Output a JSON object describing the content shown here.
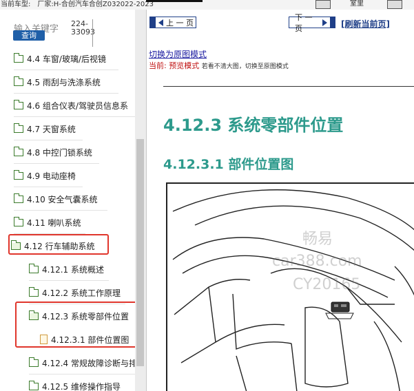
{
  "topbar": {
    "vehicle_label": "当前车型:　厂家:H-合创汽车合创Z032022-2023",
    "right_label": "室里"
  },
  "search": {
    "keyword_label": "输入关键字",
    "button": "查询",
    "code_line1": "224-",
    "code_line2": "33093"
  },
  "tree": [
    {
      "label": "4.4 车窗/玻璃/后视镜",
      "icon": "folder-icon",
      "level": 1
    },
    {
      "label": "4.5 雨刮与洗涤系统",
      "icon": "folder-icon",
      "level": 1
    },
    {
      "label": "4.6 组合仪表/驾驶员信息系",
      "icon": "folder-icon",
      "level": 1
    },
    {
      "label": "4.7 天窗系统",
      "icon": "folder-icon",
      "level": 1
    },
    {
      "label": "4.8 中控门锁系统",
      "icon": "folder-icon",
      "level": 1
    },
    {
      "label": "4.9 电动座椅",
      "icon": "folder-icon",
      "level": 1
    },
    {
      "label": "4.10 安全气囊系统",
      "icon": "folder-icon",
      "level": 1
    },
    {
      "label": "4.11 喇叭系统",
      "icon": "folder-icon",
      "level": 1
    },
    {
      "label": "4.12 行车辅助系统",
      "icon": "folder-open-icon",
      "level": 1
    },
    {
      "label": "4.12.1 系统概述",
      "icon": "folder-icon",
      "level": 2
    },
    {
      "label": "4.12.2 系统工作原理",
      "icon": "folder-icon",
      "level": 2
    },
    {
      "label": "4.12.3 系统零部件位置",
      "icon": "folder-open-icon",
      "level": 2
    },
    {
      "label": "4.12.3.1 部件位置图",
      "icon": "document-icon",
      "level": 3
    },
    {
      "label": "4.12.4 常规故障诊断与排",
      "icon": "folder-icon",
      "level": 2
    },
    {
      "label": "4.12.5 维修操作指导",
      "icon": "folder-icon",
      "level": 2
    }
  ],
  "nav": {
    "prev": "上 一 页",
    "next": "下 一 页",
    "refresh": "[刷新当前页]"
  },
  "mode": {
    "switch_link": "切换为原图模式",
    "current_key": "当前:",
    "current_value": "预览模式",
    "hint": "若看不清大图，切换至原图模式"
  },
  "content": {
    "title": "4.12.3 系统零部件位置",
    "subtitle": "4.12.3.1 部件位置图"
  },
  "watermark": {
    "line1": "畅易",
    "line2": "car388.com",
    "line3": "CY20165"
  },
  "colors": {
    "heading": "#2d9a8c",
    "highlight": "#e0352b",
    "nav_border": "#1f3f88",
    "folder": "#3a7a2a"
  }
}
